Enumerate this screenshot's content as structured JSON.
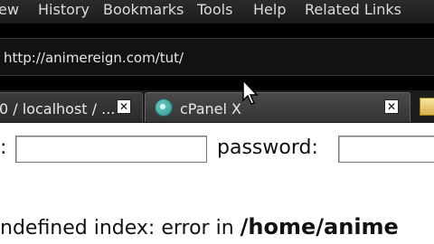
{
  "menubar": {
    "items": [
      "ew",
      "History",
      "Bookmarks",
      "Tools",
      "Help",
      "Related Links"
    ]
  },
  "address": {
    "url": "http://animereign.com/tut/"
  },
  "tabs": [
    {
      "label": "0 / localhost / ...",
      "icon": "none",
      "active": false
    },
    {
      "label": "cPanel X",
      "icon": "cpanel-icon",
      "active": true
    },
    {
      "label": "",
      "icon": "yellow-favicon",
      "active": false
    }
  ],
  "page": {
    "username_label": ":",
    "password_label": "password:",
    "error": {
      "prefix": "ndefined index: error in ",
      "path": "/home/anime"
    }
  }
}
